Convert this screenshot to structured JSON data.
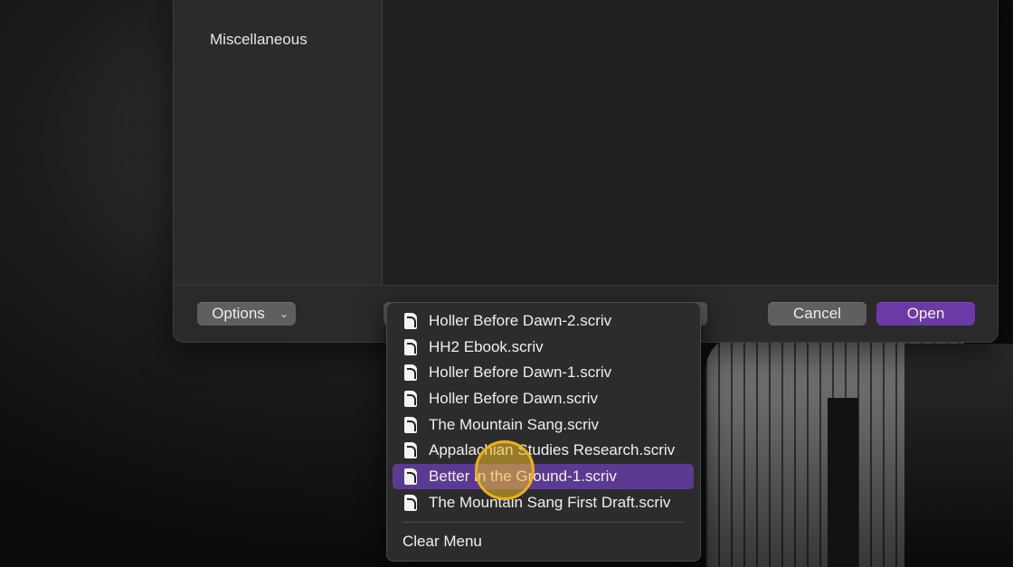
{
  "sidebar": {
    "items": [
      {
        "label": "Miscellaneous"
      }
    ]
  },
  "footer": {
    "options_label": "Options",
    "cancel_label": "Cancel",
    "open_label": "Open"
  },
  "recent_menu": {
    "items": [
      {
        "label": "Holler Before Dawn-2.scriv",
        "icon": "scrivener-file-icon"
      },
      {
        "label": "HH2 Ebook.scriv",
        "icon": "scrivener-file-icon"
      },
      {
        "label": "Holler Before Dawn-1.scriv",
        "icon": "scrivener-file-icon"
      },
      {
        "label": "Holler Before Dawn.scriv",
        "icon": "scrivener-file-icon"
      },
      {
        "label": "The Mountain Sang.scriv",
        "icon": "scrivener-file-icon"
      },
      {
        "label": "Appalachian Studies Research.scriv",
        "icon": "scrivener-file-icon"
      },
      {
        "label": "Better in the Ground-1.scriv",
        "icon": "scrivener-file-icon",
        "selected": true
      },
      {
        "label": "The Mountain Sang First Draft.scriv",
        "icon": "scrivener-file-icon"
      }
    ],
    "clear_label": "Clear Menu"
  },
  "colors": {
    "accent": "#6a3aa6",
    "selection": "#5b3b92",
    "click_indicator": "#e9b21a"
  }
}
